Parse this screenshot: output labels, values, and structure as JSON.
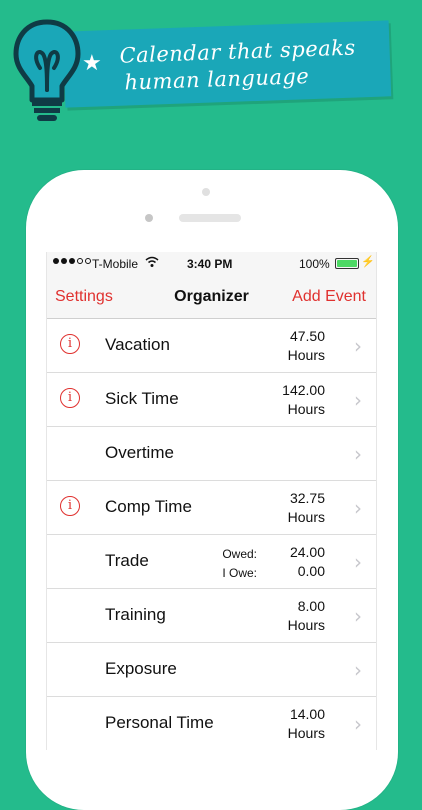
{
  "banner": {
    "line1": "Calendar that speaks",
    "line2": "human language",
    "star": "★"
  },
  "statusbar": {
    "carrier": "T-Mobile",
    "time": "3:40 PM",
    "battery": "100%",
    "battery_level": 1.0
  },
  "navbar": {
    "left": "Settings",
    "title": "Organizer",
    "right": "Add Event"
  },
  "rows": [
    {
      "label": "Vacation",
      "value1": "47.50",
      "value2": "Hours",
      "info": true
    },
    {
      "label": "Sick Time",
      "value1": "142.00",
      "value2": "Hours",
      "info": true
    },
    {
      "label": "Overtime",
      "value1": "",
      "value2": "",
      "info": false
    },
    {
      "label": "Comp Time",
      "value1": "32.75",
      "value2": "Hours",
      "info": true
    },
    {
      "label": "Trade",
      "owed_label": "Owed:",
      "iowe_label": "I Owe:",
      "value1": "24.00",
      "value2": "0.00",
      "info": false
    },
    {
      "label": "Training",
      "value1": "8.00",
      "value2": "Hours",
      "info": false
    },
    {
      "label": "Exposure",
      "value1": "",
      "value2": "",
      "info": false
    },
    {
      "label": "Personal Time",
      "value1": "14.00",
      "value2": "Hours",
      "info": false
    }
  ],
  "colors": {
    "background": "#24bb8c",
    "banner": "#1aa7b8",
    "accent_red": "#e0312f"
  },
  "icons": {
    "info": "info-circle-icon",
    "chevron": "chevron-right-icon",
    "bulb": "lightbulb-icon"
  }
}
